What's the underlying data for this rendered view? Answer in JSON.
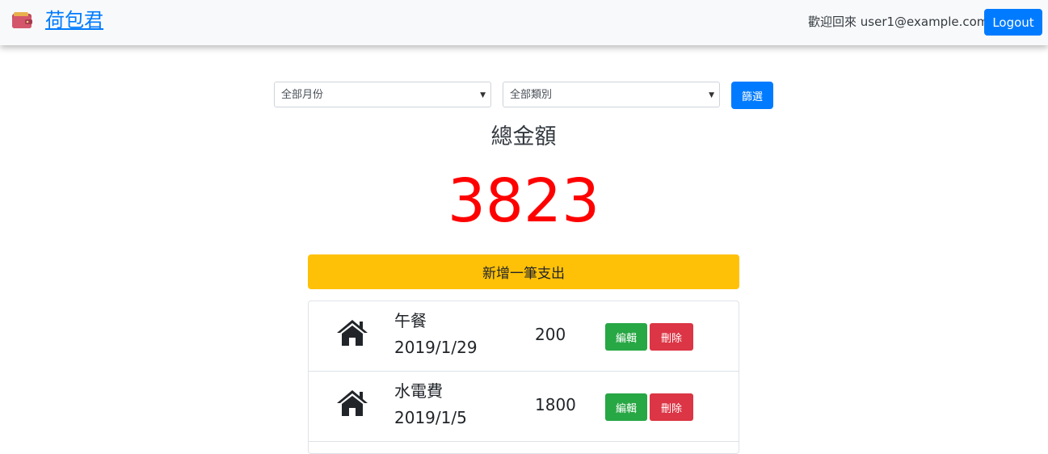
{
  "app": {
    "brand": "荷包君",
    "brand_icon": "wallet-icon",
    "welcome": "歡迎回來 user1@example.com",
    "logout_label": "Logout"
  },
  "filters": {
    "month_selected": "全部月份",
    "category_selected": "全部類別",
    "submit_label": "篩選"
  },
  "summary": {
    "title": "總金額",
    "total": "3823"
  },
  "actions": {
    "add_label": "新增一筆支出"
  },
  "expenses": [
    {
      "icon": "home-icon",
      "name": "午餐",
      "date": "2019/1/29",
      "amount": "200",
      "edit_label": "編輯",
      "delete_label": "刪除"
    },
    {
      "icon": "home-icon",
      "name": "水電費",
      "date": "2019/1/5",
      "amount": "1800",
      "edit_label": "編輯",
      "delete_label": "刪除"
    }
  ],
  "colors": {
    "primary": "#007bff",
    "warning": "#ffc107",
    "success": "#28a745",
    "danger": "#dc3545",
    "total_text": "#ff0000"
  }
}
